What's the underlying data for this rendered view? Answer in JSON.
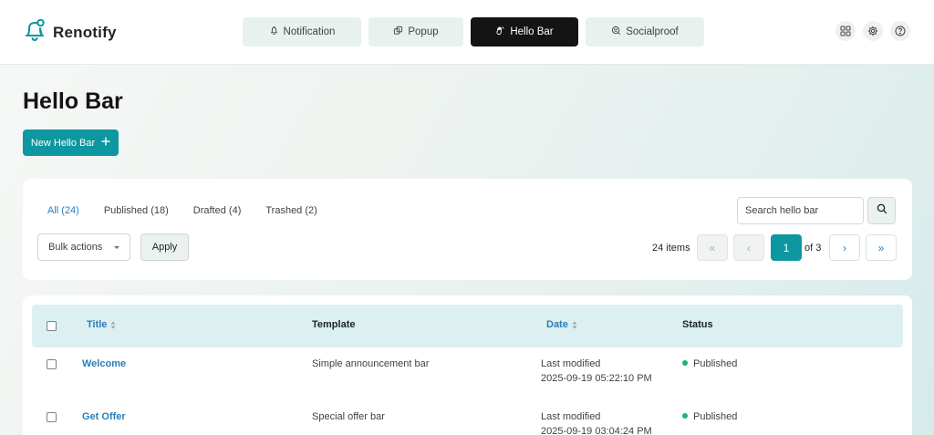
{
  "brand": {
    "name": "Renotify",
    "icon": "bell-icon"
  },
  "nav": {
    "tabs": [
      {
        "label": "Notification",
        "icon": "bell-icon",
        "active": false
      },
      {
        "label": "Popup",
        "icon": "popup-icon",
        "active": false
      },
      {
        "label": "Hello Bar",
        "icon": "hand-wave-icon",
        "active": true
      },
      {
        "label": "Socialproof",
        "icon": "socialproof-icon",
        "active": false
      }
    ],
    "right_icons": [
      "apps-grid-icon",
      "gear-icon",
      "help-icon"
    ]
  },
  "page": {
    "title": "Hello Bar",
    "new_button_label": "New Hello Bar",
    "new_button_icon": "plus-icon"
  },
  "filters": {
    "links": [
      {
        "label": "All (24)",
        "current": true
      },
      {
        "label": "Published (18)",
        "current": false
      },
      {
        "label": "Drafted (4)",
        "current": false
      },
      {
        "label": "Trashed (2)",
        "current": false
      }
    ],
    "search_value": "Search hello bar",
    "search_icon": "search-icon",
    "bulk_actions_label": "Bulk actions",
    "apply_label": "Apply"
  },
  "pagination": {
    "items_text": "24 items",
    "first_label": "«",
    "prev_label": "‹",
    "current_page": "1",
    "of_text": "of 3",
    "next_label": "›",
    "last_label": "»"
  },
  "table": {
    "headers": {
      "title": "Title",
      "template": "Template",
      "date": "Date",
      "status": "Status"
    },
    "rows": [
      {
        "title": "Welcome",
        "template": "Simple announcement bar",
        "date_label": "Last modified",
        "date": "2025-09-19 05:22:10 PM",
        "status": "Published"
      },
      {
        "title": "Get Offer",
        "template": "Special offer bar",
        "date_label": "Last modified",
        "date": "2025-09-19 03:04:24 PM",
        "status": "Published"
      }
    ]
  },
  "colors": {
    "accent": "#0d97a0",
    "link": "#2a7db8",
    "active_tab": "#141414",
    "status_published": "#1db36e"
  }
}
